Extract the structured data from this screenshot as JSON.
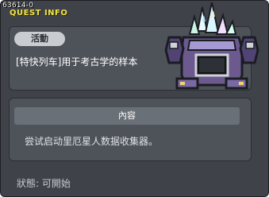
{
  "quest": {
    "id": "63614-0",
    "header": "QUEST INFO"
  },
  "activity": {
    "badge": "活動",
    "subject": "[特快列车]用于考古学的样本"
  },
  "content": {
    "header": "內容",
    "text": "尝试启动里厄星人数据收集器。"
  },
  "status": {
    "text": "狀態:  可開始"
  },
  "icons": {
    "portrait": "crystal-machine-icon"
  }
}
